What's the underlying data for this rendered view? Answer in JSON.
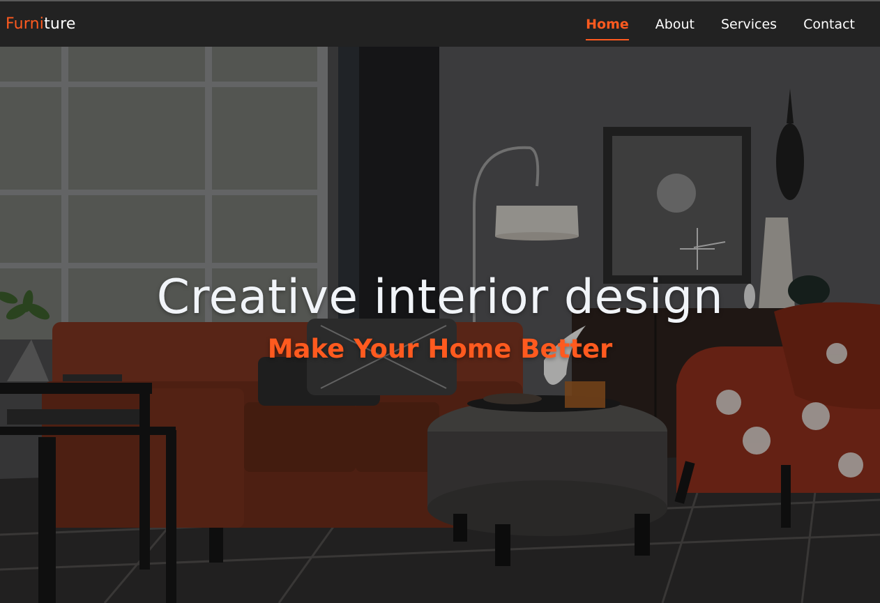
{
  "brand": {
    "part1": "Furni",
    "part2": "ture",
    "accent_color": "#ff5a1f"
  },
  "nav": {
    "items": [
      {
        "label": "Home",
        "active": true
      },
      {
        "label": "About",
        "active": false
      },
      {
        "label": "Services",
        "active": false
      },
      {
        "label": "Contact",
        "active": false
      }
    ]
  },
  "hero": {
    "title": "Creative interior design",
    "subtitle": "Make Your Home Better",
    "background_description_icon": "living-room-photo"
  },
  "colors": {
    "navbar": "#222222",
    "accent": "#ff5a1f",
    "title": "#f1f4f8"
  }
}
